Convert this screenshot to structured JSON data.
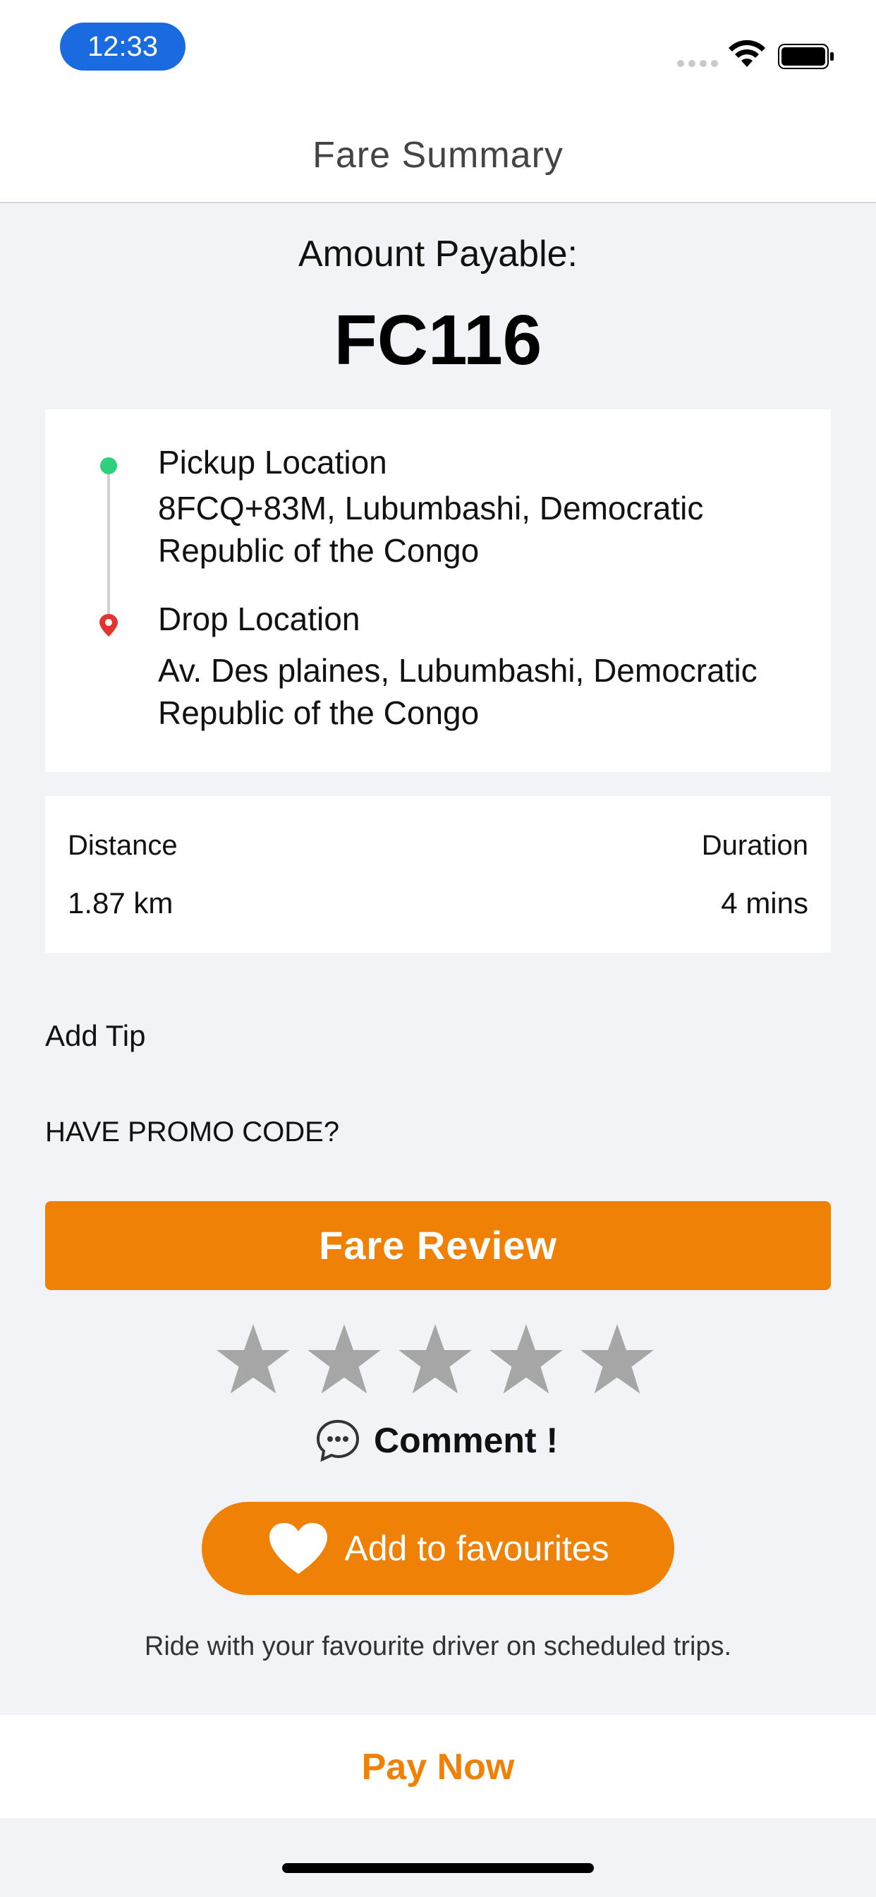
{
  "status_bar": {
    "time": "12:33"
  },
  "header": {
    "title": "Fare Summary"
  },
  "amount": {
    "label": "Amount Payable:",
    "value": "FC116"
  },
  "pickup": {
    "title": "Pickup Location",
    "address": "8FCQ+83M, Lubumbashi, Democratic Republic of the Congo"
  },
  "drop": {
    "title": "Drop Location",
    "address": "Av. Des plaines, Lubumbashi, Democratic Republic of the Congo"
  },
  "trip": {
    "distance_label": "Distance",
    "distance_value": "1.87 km",
    "duration_label": "Duration",
    "duration_value": "4 mins"
  },
  "add_tip": "Add Tip",
  "promo": "HAVE PROMO CODE?",
  "fare_review_button": "Fare Review",
  "rating": {
    "max": 5,
    "value": 0,
    "star_color": "#a6a6a6"
  },
  "comment": {
    "label": "Comment !",
    "icon": "chat-bubble-icon"
  },
  "favourites": {
    "button_label": "Add to favourites",
    "icon": "heart-icon",
    "hint": "Ride with your favourite driver on scheduled trips."
  },
  "pay_now": "Pay Now",
  "colors": {
    "accent": "#ef8106",
    "pickup_dot": "#2ed07f",
    "drop_pin": "#e3342f",
    "time_pill": "#1a6be0"
  }
}
